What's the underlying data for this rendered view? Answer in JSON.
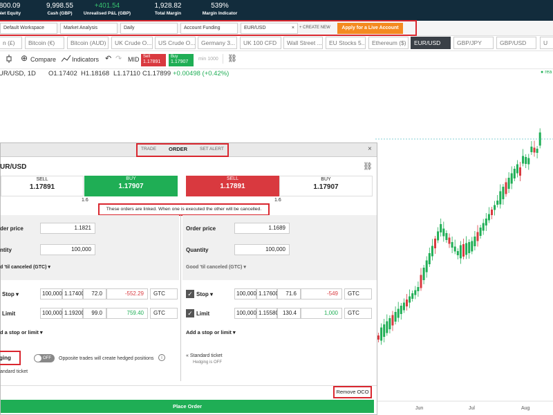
{
  "account_bar": [
    {
      "value": "800.09",
      "label": "Net Equity"
    },
    {
      "value": "9,998.55",
      "label": "Cash (GBP)"
    },
    {
      "value": "+401.54",
      "label": "Unrealised P&L (GBP)"
    },
    {
      "value": "1,928.82",
      "label": "Total Margin"
    },
    {
      "value": "539%",
      "label": "Margin Indicator"
    }
  ],
  "workspace_tabs": [
    "Default Workspace",
    "Market Analysis",
    "Daily",
    "Account Funding",
    "EUR/USD"
  ],
  "create_new": "+ CREATE NEW",
  "apply_live": "Apply for a Live Account",
  "instrument_tabs": [
    "n (£)",
    "Bitcoin (€)",
    "Bitcoin (AUD)",
    "UK Crude O...",
    "US Crude O...",
    "Germany 3...",
    "UK 100 CFD",
    "Wall Street ...",
    "EU Stocks 5...",
    "Ethereum ($)",
    "EUR/USD",
    "GBP/JPY",
    "GBP/USD",
    "U"
  ],
  "toolbar": {
    "compare": "Compare",
    "indicators": "Indicators",
    "mid": "MID",
    "sell_label": "Sell",
    "sell_price": "1.17891",
    "buy_label": "Buy",
    "buy_price": "1.17907",
    "min": "min 1000"
  },
  "ohlc": {
    "symbol": "UR/USD, 1D",
    "o": "O1.17402",
    "h": "H1.18168",
    "l": "L1.17110",
    "c": "C1.17899",
    "change": "+0.00498 (+0.42%)"
  },
  "chart_data": {
    "type": "candlestick",
    "x_ticks": [
      "Jun",
      "Jul",
      "Aug"
    ],
    "status": "rea"
  },
  "dialog": {
    "tabs": [
      "TRADE",
      "ORDER",
      "SET ALERT"
    ],
    "selected_tab": "ORDER",
    "instrument": "UR/USD",
    "left": {
      "sell_label": "SELL",
      "sell_price": "1.17891",
      "buy_label": "BUY",
      "buy_price": "1.17907",
      "order_price_label": "der price",
      "order_price": "1.1821",
      "quantity_label": "ntity",
      "quantity": "100,000",
      "validity": "d 'til canceled (GTC) ▾",
      "stop_label": "Stop ▾",
      "stop_qty": "100,000",
      "stop_price": "1.17400",
      "stop_points": "72.0",
      "stop_pnl": "-552.29",
      "stop_tif": "GTC",
      "limit_label": "Limit",
      "limit_qty": "100,000",
      "limit_price": "1.19200",
      "limit_points": "99.0",
      "limit_pnl": "759.40",
      "limit_tif": "GTC",
      "add_stop": "d a stop or limit ▾",
      "hedging": "ging",
      "toggle": "OFF",
      "hedge_note": "Opposite trades will create hedged positions",
      "standard": "andard ticket"
    },
    "right": {
      "sell_label": "SELL",
      "sell_price": "1.17891",
      "buy_label": "BUY",
      "buy_price": "1.17907",
      "order_price_label": "Order price",
      "order_price": "1.1689",
      "quantity_label": "Quantity",
      "quantity": "100,000",
      "validity": "Good 'til canceled (GTC) ▾",
      "stop_label": "Stop ▾",
      "stop_qty": "100,000",
      "stop_price": "1.17600",
      "stop_points": "71.6",
      "stop_pnl": "-549",
      "stop_tif": "GTC",
      "limit_label": "Limit",
      "limit_qty": "100,000",
      "limit_price": "1.15580",
      "limit_points": "130.4",
      "limit_pnl": "1,000",
      "limit_tif": "GTC",
      "add_stop": "Add a stop or limit ▾",
      "standard": "Standard ticket",
      "hedging_off": "Hedging is OFF"
    },
    "spread": "1.6",
    "linked_note": "These orders are linked. When one is executed the other will be cancelled.",
    "remove_oco": "Remove OCO",
    "place_order": "Place Order"
  }
}
